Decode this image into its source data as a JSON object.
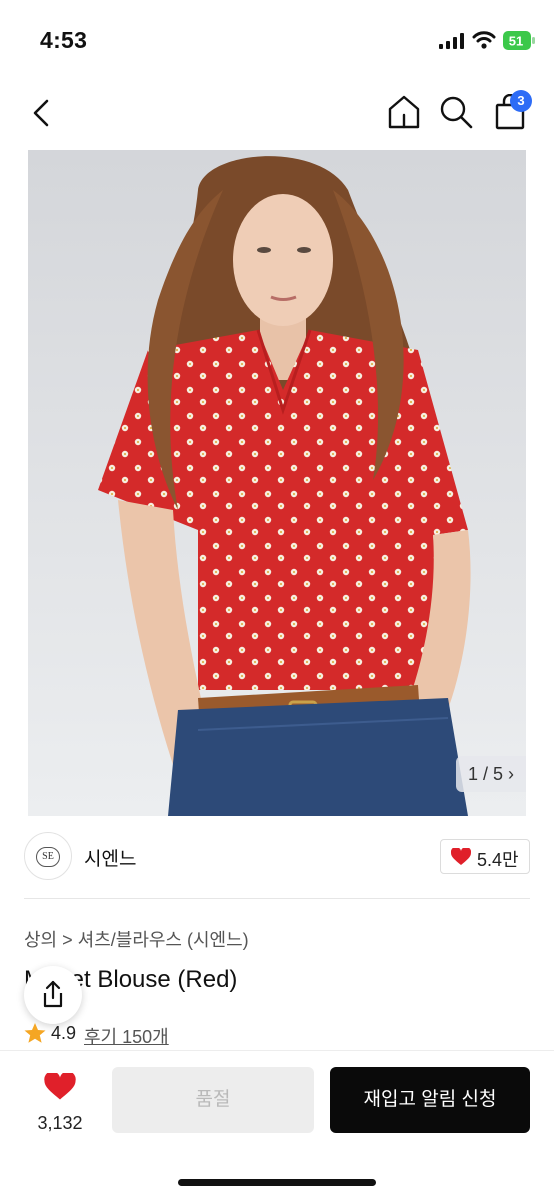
{
  "status_bar": {
    "time": "4:53",
    "battery": "51"
  },
  "header": {
    "cart_count": "3",
    "icons": [
      "back-icon",
      "home-icon",
      "search-icon",
      "shopping-bag-icon"
    ]
  },
  "hero": {
    "counter": "1 / 5 ›"
  },
  "brand": {
    "logo_text": "SE",
    "name": "시엔느",
    "likes": "5.4만"
  },
  "product": {
    "category": "상의 > 셔츠/블라우스 (시엔느)",
    "title": "M    et Blouse (Red)",
    "rating": "4.9",
    "reviews": "후기 150개"
  },
  "bottom_bar": {
    "favorites": "3,132",
    "soldout_label": "품절",
    "restock_label": "재입고 알림 신청"
  },
  "colors": {
    "accent_blue": "#2d6cf6",
    "heart_red": "#e0202a",
    "star_orange": "#f5a623",
    "button_dark": "#0a0a0a"
  }
}
